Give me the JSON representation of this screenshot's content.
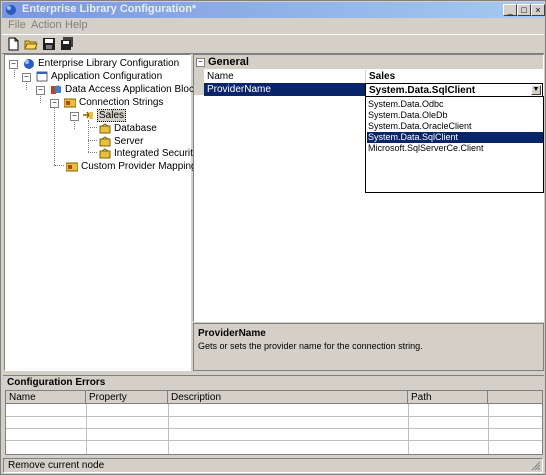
{
  "window": {
    "title": "Enterprise Library Configuration*"
  },
  "window_controls": {
    "minimize": "_",
    "maximize": "□",
    "close": "×"
  },
  "menu": {
    "file": "File",
    "action": "Action",
    "help": "Help"
  },
  "toolbar": {
    "icons": [
      "new-file-icon",
      "open-folder-icon",
      "save-icon",
      "save-all-icon"
    ]
  },
  "tree": {
    "root": "Enterprise Library Configuration",
    "app_config": "Application Configuration",
    "data_access": "Data Access Application Block",
    "connection_strings": "Connection Strings",
    "sales": "Sales",
    "database": "Database",
    "server": "Server",
    "integrated_security": "Integrated Security",
    "custom_provider": "Custom Provider Mappings"
  },
  "properties": {
    "section": "General",
    "rows": [
      {
        "name": "Name",
        "value": "Sales"
      },
      {
        "name": "ProviderName",
        "value": "System.Data.SqlClient"
      }
    ],
    "dropdown_options": [
      "System.Data.Odbc",
      "System.Data.OleDb",
      "System.Data.OracleClient",
      "System.Data.SqlClient",
      "Microsoft.SqlServerCe.Client"
    ],
    "selected_option": "System.Data.SqlClient"
  },
  "description": {
    "title": "ProviderName",
    "text": "Gets or sets the provider name for the connection string."
  },
  "errors": {
    "title": "Configuration Errors",
    "columns": [
      "Name",
      "Property",
      "Description",
      "Path"
    ]
  },
  "status": {
    "text": "Remove current node"
  }
}
